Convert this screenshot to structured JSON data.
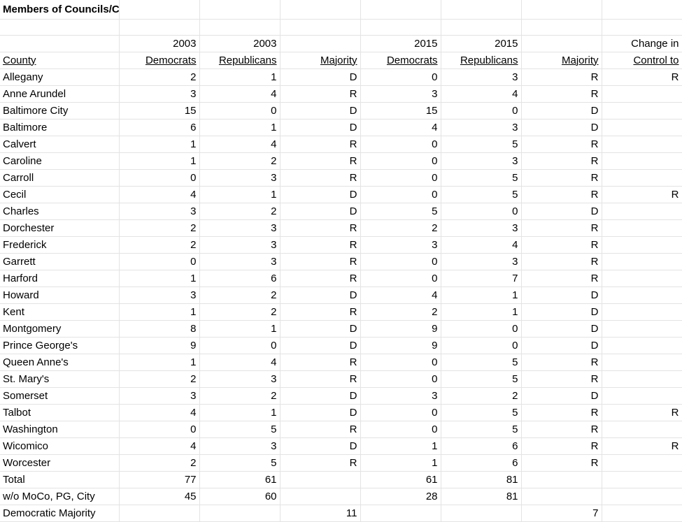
{
  "title": "Members of Councils/Commissions by County",
  "header_row1": [
    "",
    "2003",
    "2003",
    "",
    "2015",
    "2015",
    "",
    "Change in"
  ],
  "header_row2": [
    "County",
    "Democrats",
    "Republicans",
    "Majority",
    "Democrats",
    "Republicans",
    "Majority",
    "Control to"
  ],
  "rows": [
    [
      "Allegany",
      "2",
      "1",
      "D",
      "0",
      "3",
      "R",
      "R"
    ],
    [
      "Anne Arundel",
      "3",
      "4",
      "R",
      "3",
      "4",
      "R",
      ""
    ],
    [
      "Baltimore City",
      "15",
      "0",
      "D",
      "15",
      "0",
      "D",
      ""
    ],
    [
      "Baltimore",
      "6",
      "1",
      "D",
      "4",
      "3",
      "D",
      ""
    ],
    [
      "Calvert",
      "1",
      "4",
      "R",
      "0",
      "5",
      "R",
      ""
    ],
    [
      "Caroline",
      "1",
      "2",
      "R",
      "0",
      "3",
      "R",
      ""
    ],
    [
      "Carroll",
      "0",
      "3",
      "R",
      "0",
      "5",
      "R",
      ""
    ],
    [
      "Cecil",
      "4",
      "1",
      "D",
      "0",
      "5",
      "R",
      "R"
    ],
    [
      "Charles",
      "3",
      "2",
      "D",
      "5",
      "0",
      "D",
      ""
    ],
    [
      "Dorchester",
      "2",
      "3",
      "R",
      "2",
      "3",
      "R",
      ""
    ],
    [
      "Frederick",
      "2",
      "3",
      "R",
      "3",
      "4",
      "R",
      ""
    ],
    [
      "Garrett",
      "0",
      "3",
      "R",
      "0",
      "3",
      "R",
      ""
    ],
    [
      "Harford",
      "1",
      "6",
      "R",
      "0",
      "7",
      "R",
      ""
    ],
    [
      "Howard",
      "3",
      "2",
      "D",
      "4",
      "1",
      "D",
      ""
    ],
    [
      "Kent",
      "1",
      "2",
      "R",
      "2",
      "1",
      "D",
      ""
    ],
    [
      "Montgomery",
      "8",
      "1",
      "D",
      "9",
      "0",
      "D",
      ""
    ],
    [
      "Prince George's",
      "9",
      "0",
      "D",
      "9",
      "0",
      "D",
      ""
    ],
    [
      "Queen Anne's",
      "1",
      "4",
      "R",
      "0",
      "5",
      "R",
      ""
    ],
    [
      "St. Mary's",
      "2",
      "3",
      "R",
      "0",
      "5",
      "R",
      ""
    ],
    [
      "Somerset",
      "3",
      "2",
      "D",
      "3",
      "2",
      "D",
      ""
    ],
    [
      "Talbot",
      "4",
      "1",
      "D",
      "0",
      "5",
      "R",
      "R"
    ],
    [
      "Washington",
      "0",
      "5",
      "R",
      "0",
      "5",
      "R",
      ""
    ],
    [
      "Wicomico",
      "4",
      "3",
      "D",
      "1",
      "6",
      "R",
      "R"
    ],
    [
      "Worcester",
      "2",
      "5",
      "R",
      "1",
      "6",
      "R",
      ""
    ]
  ],
  "total_row": [
    "Total",
    "77",
    "61",
    "",
    "61",
    "81",
    "",
    ""
  ],
  "wo_row": [
    "w/o MoCo, PG, City",
    "45",
    "60",
    "",
    "28",
    "81",
    "",
    ""
  ],
  "majority_row": [
    "Democratic Majority",
    "",
    "",
    "11",
    "",
    "",
    "7",
    ""
  ]
}
